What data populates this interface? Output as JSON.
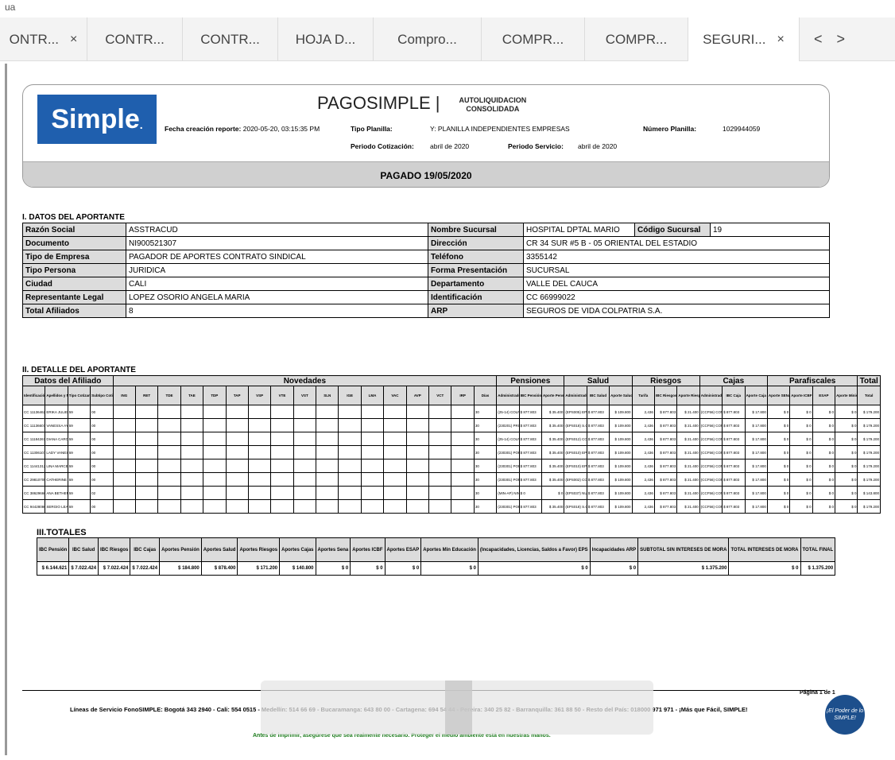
{
  "topcut": "ua",
  "tabs": [
    {
      "label": "ONTR...",
      "close": "×",
      "width": 110
    },
    {
      "label": "CONTR...",
      "close": "",
      "width": 120
    },
    {
      "label": "CONTR...",
      "close": "",
      "width": 120
    },
    {
      "label": "HOJA D...",
      "close": "",
      "width": 120
    },
    {
      "label": "Compro...",
      "close": "",
      "width": 136
    },
    {
      "label": "COMPR...",
      "close": "",
      "width": 130
    },
    {
      "label": "COMPR...",
      "close": "",
      "width": 130
    },
    {
      "label": "SEGURI...",
      "close": "×",
      "width": 140
    }
  ],
  "nav": {
    "prev": "<",
    "next": ">"
  },
  "header": {
    "brand": "Simple",
    "title": "PAGOSIMPLE |",
    "subtitle1": "AUTOLIQUIDACION",
    "subtitle2": "CONSOLIDADA",
    "fecha_label": "Fecha creación reporte:",
    "fecha_value": "2020-05-20, 03:15:35 PM",
    "tipo_label": "Tipo Planilla:",
    "tipo_value": "Y: PLANILLA INDEPENDIENTES EMPRESAS",
    "num_label": "Número Planilla:",
    "num_value": "1029944059",
    "periodo_cot_label": "Periodo Cotización:",
    "periodo_cot_value": "abril de 2020",
    "periodo_serv_label": "Periodo Servicio:",
    "periodo_serv_value": "abril de 2020",
    "pagado": "PAGADO 19/05/2020"
  },
  "sec1": {
    "title": "I. DATOS DEL APORTANTE",
    "rows": [
      [
        "Razón Social",
        "ASSTRACUD",
        "Nombre Sucursal",
        "HOSPITAL DPTAL MARIO",
        "Código Sucursal",
        "19"
      ],
      [
        "Documento",
        "NI900521307",
        "Dirección",
        "CR 34 SUR #5 B - 05 ORIENTAL DEL ESTADIO",
        "",
        ""
      ],
      [
        "Tipo de Empresa",
        "PAGADOR DE APORTES CONTRATO SINDICAL",
        "Teléfono",
        "3355142",
        "",
        ""
      ],
      [
        "Tipo Persona",
        "JURIDICA",
        "Forma Presentación",
        "SUCURSAL",
        "",
        ""
      ],
      [
        "Ciudad",
        "CALI",
        "Departamento",
        "VALLE DEL CAUCA",
        "",
        ""
      ],
      [
        "Representante Legal",
        "LOPEZ OSORIO ANGELA MARIA",
        "Identificación",
        "CC 66999022",
        "",
        ""
      ],
      [
        "Total Afiliados",
        "8",
        "ARP",
        "SEGUROS DE VIDA COLPATRIA S.A.",
        "",
        ""
      ]
    ]
  },
  "sec2": {
    "title": "II. DETALLE DEL APORTANTE",
    "groups": [
      "Datos del Afiliado",
      "Novedades",
      "Pensiones",
      "Salud",
      "Riesgos",
      "Cajas",
      "Parafiscales",
      "Total"
    ],
    "cols": [
      "Identificación",
      "Apellidos y Nombres",
      "Tipo Cotizante",
      "Subtipo Cotizante",
      "ING",
      "RET",
      "TDE",
      "TAE",
      "TDP",
      "TAP",
      "VSP",
      "VTE",
      "VST",
      "SLN",
      "IGE",
      "LMA",
      "VAC",
      "AVP",
      "VCT",
      "IRP",
      "Días",
      "Administradora",
      "IBC Pensión",
      "Aporte Pensión",
      "Administradora",
      "IBC Salud",
      "Aporte Salud",
      "Tarifa",
      "IBC Riesgos",
      "Aporte Riesgos",
      "Administradora",
      "IBC Caja",
      "Aporte Caja",
      "Aporte SENA",
      "Aporte ICBF",
      "ESAP",
      "Aporte Ministerio",
      "Total"
    ],
    "rows": [
      [
        "CC 1113646288",
        "ERIKA JULIETH PINO CAICEDO",
        "59",
        "00",
        "30",
        "(25-14) COLPENSIONES",
        "$ 877.803",
        "$ 35.400",
        "(EPS005) EPS SANITAS",
        "$ 877.803",
        "$ 109.800",
        "2,436",
        "$ 877.803",
        "$ 21.400",
        "(CCF56) COMFENALCO VALLE",
        "$ 877.803",
        "$ 17.800",
        "$ 0",
        "$ 0",
        "$ 0",
        "$ 0",
        "$ 179.200"
      ],
      [
        "CC 1113660713",
        "VANESSA AYALA POTES",
        "59",
        "00",
        "30",
        "(230201) PROTECCION (ING + PROTECCION)",
        "$ 877.803",
        "$ 35.400",
        "(EPS018) S.O.S EPS",
        "$ 877.803",
        "$ 109.800",
        "2,436",
        "$ 877.803",
        "$ 21.400",
        "(CCF56) COMFENALCO VALLE",
        "$ 877.803",
        "$ 17.800",
        "$ 0",
        "$ 0",
        "$ 0",
        "$ 0",
        "$ 179.200"
      ],
      [
        "CC 1118426734",
        "DIANA CAROLINA REBELLON RUIZ",
        "59",
        "00",
        "30",
        "(25-14) COLPENSIONES",
        "$ 877.803",
        "$ 35.400",
        "(EPS012) COMFENALCO VALLE EPS",
        "$ 877.803",
        "$ 109.800",
        "2,436",
        "$ 877.803",
        "$ 21.400",
        "(CCF56) COMFENALCO VALLE",
        "$ 877.803",
        "$ 17.800",
        "$ 0",
        "$ 0",
        "$ 0",
        "$ 0",
        "$ 179.200"
      ],
      [
        "CC 1130610754",
        "LADY VANESSA RAMIREZ CAMPO",
        "59",
        "00",
        "30",
        "(230301) PORVENIR",
        "$ 877.803",
        "$ 35.400",
        "(EPS010) EPS SURA",
        "$ 877.803",
        "$ 109.800",
        "2,436",
        "$ 877.803",
        "$ 21.400",
        "(CCF56) COMFENALCO VALLE",
        "$ 877.803",
        "$ 17.800",
        "$ 0",
        "$ 0",
        "$ 0",
        "$ 0",
        "$ 179.200"
      ],
      [
        "CC 1144131248",
        "LINA MARCELA SEGURA RIVERA",
        "59",
        "00",
        "30",
        "(230301) PORVENIR",
        "$ 877.803",
        "$ 35.400",
        "(EPS010) EPS SURA",
        "$ 877.803",
        "$ 109.800",
        "2,436",
        "$ 877.803",
        "$ 21.400",
        "(CCF56) COMFENALCO VALLE",
        "$ 877.803",
        "$ 17.800",
        "$ 0",
        "$ 0",
        "$ 0",
        "$ 0",
        "$ 179.200"
      ],
      [
        "CC 29810705",
        "CATHERINE CANAVERAL CANAVERAL",
        "59",
        "00",
        "30",
        "(230301) PORVENIR",
        "$ 877.803",
        "$ 35.400",
        "(EPS002) COOMEVA EPS",
        "$ 877.803",
        "$ 109.800",
        "2,436",
        "$ 877.803",
        "$ 21.400",
        "(CCF56) COMFENALCO VALLE",
        "$ 877.803",
        "$ 17.800",
        "$ 0",
        "$ 0",
        "$ 0",
        "$ 0",
        "$ 179.200"
      ],
      [
        "CC 38629660",
        "ANA BETHER GONGORA JIMENEZ",
        "59",
        "02",
        "30",
        "(MIN-AP) NINGUNA AFP",
        "$ 0",
        "$ 0",
        "(EPS037) NUEVA EPS",
        "$ 877.803",
        "$ 109.800",
        "2,436",
        "$ 877.803",
        "$ 21.400",
        "(CCF56) COMFENALCO VALLE",
        "$ 877.803",
        "$ 17.800",
        "$ 0",
        "$ 0",
        "$ 0",
        "$ 0",
        "$ 143.800"
      ],
      [
        "CC 94428086",
        "SERGIO LEANDRO MARCELO BARRAGAN CONTRERAS",
        "59",
        "00",
        "30",
        "(230301) PORVENIR",
        "$ 877.803",
        "$ 35.400",
        "(EPS018) S.O.S EPS",
        "$ 877.803",
        "$ 109.800",
        "2,436",
        "$ 877.803",
        "$ 21.400",
        "(CCF56) COMFENALCO VALLE",
        "$ 877.803",
        "$ 17.800",
        "$ 0",
        "$ 0",
        "$ 0",
        "$ 0",
        "$ 179.200"
      ]
    ]
  },
  "sec3": {
    "title": "III.TOTALES",
    "headers": [
      "IBC Pensión",
      "IBC Salud",
      "IBC Riesgos",
      "IBC Cajas",
      "Aportes Pensión",
      "Aportes Salud",
      "Aportes Riesgos",
      "Aportes Cajas",
      "Aportes Sena",
      "Aportes ICBF",
      "Aportes ESAP",
      "Aportes Min Educación",
      "(Incapacidades, Licencias, Saldos a Favor) EPS",
      "Incapacidades ARP",
      "SUBTOTAL SIN INTERESES DE MORA",
      "TOTAL INTERESES DE MORA",
      "TOTAL FINAL"
    ],
    "values": [
      "$ 6.144.621",
      "$ 7.022.424",
      "$ 7.022.424",
      "$ 7.022.424",
      "$ 184.800",
      "$ 878.400",
      "$ 171.200",
      "$ 140.800",
      "$ 0",
      "$ 0",
      "$ 0",
      "$ 0",
      "$ 0",
      "$ 0",
      "$ 1.375.200",
      "$ 0",
      "$ 1.375.200"
    ]
  },
  "footer": {
    "line1": "Líneas de Servicio FonoSIMPLE: Bogotá 343 2940 - Cali: 554 0515 - Medellín: 514 66 69 - Bucaramanga: 643 80 00 - Cartagena: 694 54 44 - Pereira: 340 25 82 - Barranquilla: 361 88 50 - Resto del País: 018000 971 971 - ¡Más que Fácil, SIMPLE!",
    "line2": "Antes de imprimir, asegúrese que sea realmente necesario. Proteger el medio ambiente está en nuestras manos.",
    "page": "Página 1 de 1",
    "badge": "¡El Poder de lo SIMPLE!"
  }
}
